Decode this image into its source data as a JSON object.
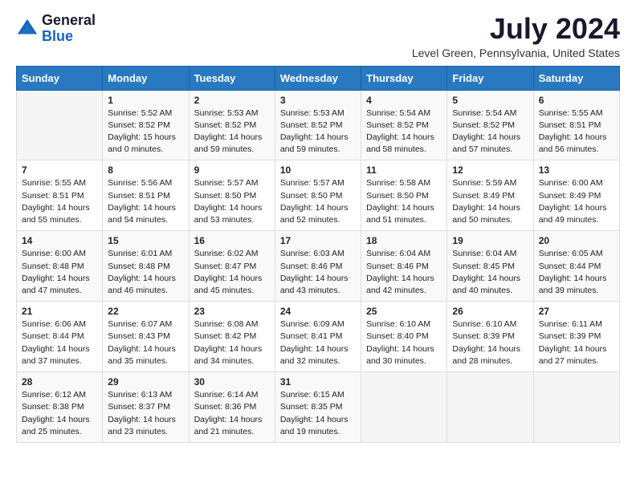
{
  "logo": {
    "general": "General",
    "blue": "Blue"
  },
  "title": "July 2024",
  "subtitle": "Level Green, Pennsylvania, United States",
  "days_of_week": [
    "Sunday",
    "Monday",
    "Tuesday",
    "Wednesday",
    "Thursday",
    "Friday",
    "Saturday"
  ],
  "weeks": [
    [
      {
        "day": "",
        "sunrise": "",
        "sunset": "",
        "daylight": ""
      },
      {
        "day": "1",
        "sunrise": "Sunrise: 5:52 AM",
        "sunset": "Sunset: 8:52 PM",
        "daylight": "Daylight: 15 hours and 0 minutes."
      },
      {
        "day": "2",
        "sunrise": "Sunrise: 5:53 AM",
        "sunset": "Sunset: 8:52 PM",
        "daylight": "Daylight: 14 hours and 59 minutes."
      },
      {
        "day": "3",
        "sunrise": "Sunrise: 5:53 AM",
        "sunset": "Sunset: 8:52 PM",
        "daylight": "Daylight: 14 hours and 59 minutes."
      },
      {
        "day": "4",
        "sunrise": "Sunrise: 5:54 AM",
        "sunset": "Sunset: 8:52 PM",
        "daylight": "Daylight: 14 hours and 58 minutes."
      },
      {
        "day": "5",
        "sunrise": "Sunrise: 5:54 AM",
        "sunset": "Sunset: 8:52 PM",
        "daylight": "Daylight: 14 hours and 57 minutes."
      },
      {
        "day": "6",
        "sunrise": "Sunrise: 5:55 AM",
        "sunset": "Sunset: 8:51 PM",
        "daylight": "Daylight: 14 hours and 56 minutes."
      }
    ],
    [
      {
        "day": "7",
        "sunrise": "Sunrise: 5:55 AM",
        "sunset": "Sunset: 8:51 PM",
        "daylight": "Daylight: 14 hours and 55 minutes."
      },
      {
        "day": "8",
        "sunrise": "Sunrise: 5:56 AM",
        "sunset": "Sunset: 8:51 PM",
        "daylight": "Daylight: 14 hours and 54 minutes."
      },
      {
        "day": "9",
        "sunrise": "Sunrise: 5:57 AM",
        "sunset": "Sunset: 8:50 PM",
        "daylight": "Daylight: 14 hours and 53 minutes."
      },
      {
        "day": "10",
        "sunrise": "Sunrise: 5:57 AM",
        "sunset": "Sunset: 8:50 PM",
        "daylight": "Daylight: 14 hours and 52 minutes."
      },
      {
        "day": "11",
        "sunrise": "Sunrise: 5:58 AM",
        "sunset": "Sunset: 8:50 PM",
        "daylight": "Daylight: 14 hours and 51 minutes."
      },
      {
        "day": "12",
        "sunrise": "Sunrise: 5:59 AM",
        "sunset": "Sunset: 8:49 PM",
        "daylight": "Daylight: 14 hours and 50 minutes."
      },
      {
        "day": "13",
        "sunrise": "Sunrise: 6:00 AM",
        "sunset": "Sunset: 8:49 PM",
        "daylight": "Daylight: 14 hours and 49 minutes."
      }
    ],
    [
      {
        "day": "14",
        "sunrise": "Sunrise: 6:00 AM",
        "sunset": "Sunset: 8:48 PM",
        "daylight": "Daylight: 14 hours and 47 minutes."
      },
      {
        "day": "15",
        "sunrise": "Sunrise: 6:01 AM",
        "sunset": "Sunset: 8:48 PM",
        "daylight": "Daylight: 14 hours and 46 minutes."
      },
      {
        "day": "16",
        "sunrise": "Sunrise: 6:02 AM",
        "sunset": "Sunset: 8:47 PM",
        "daylight": "Daylight: 14 hours and 45 minutes."
      },
      {
        "day": "17",
        "sunrise": "Sunrise: 6:03 AM",
        "sunset": "Sunset: 8:46 PM",
        "daylight": "Daylight: 14 hours and 43 minutes."
      },
      {
        "day": "18",
        "sunrise": "Sunrise: 6:04 AM",
        "sunset": "Sunset: 8:46 PM",
        "daylight": "Daylight: 14 hours and 42 minutes."
      },
      {
        "day": "19",
        "sunrise": "Sunrise: 6:04 AM",
        "sunset": "Sunset: 8:45 PM",
        "daylight": "Daylight: 14 hours and 40 minutes."
      },
      {
        "day": "20",
        "sunrise": "Sunrise: 6:05 AM",
        "sunset": "Sunset: 8:44 PM",
        "daylight": "Daylight: 14 hours and 39 minutes."
      }
    ],
    [
      {
        "day": "21",
        "sunrise": "Sunrise: 6:06 AM",
        "sunset": "Sunset: 8:44 PM",
        "daylight": "Daylight: 14 hours and 37 minutes."
      },
      {
        "day": "22",
        "sunrise": "Sunrise: 6:07 AM",
        "sunset": "Sunset: 8:43 PM",
        "daylight": "Daylight: 14 hours and 35 minutes."
      },
      {
        "day": "23",
        "sunrise": "Sunrise: 6:08 AM",
        "sunset": "Sunset: 8:42 PM",
        "daylight": "Daylight: 14 hours and 34 minutes."
      },
      {
        "day": "24",
        "sunrise": "Sunrise: 6:09 AM",
        "sunset": "Sunset: 8:41 PM",
        "daylight": "Daylight: 14 hours and 32 minutes."
      },
      {
        "day": "25",
        "sunrise": "Sunrise: 6:10 AM",
        "sunset": "Sunset: 8:40 PM",
        "daylight": "Daylight: 14 hours and 30 minutes."
      },
      {
        "day": "26",
        "sunrise": "Sunrise: 6:10 AM",
        "sunset": "Sunset: 8:39 PM",
        "daylight": "Daylight: 14 hours and 28 minutes."
      },
      {
        "day": "27",
        "sunrise": "Sunrise: 6:11 AM",
        "sunset": "Sunset: 8:39 PM",
        "daylight": "Daylight: 14 hours and 27 minutes."
      }
    ],
    [
      {
        "day": "28",
        "sunrise": "Sunrise: 6:12 AM",
        "sunset": "Sunset: 8:38 PM",
        "daylight": "Daylight: 14 hours and 25 minutes."
      },
      {
        "day": "29",
        "sunrise": "Sunrise: 6:13 AM",
        "sunset": "Sunset: 8:37 PM",
        "daylight": "Daylight: 14 hours and 23 minutes."
      },
      {
        "day": "30",
        "sunrise": "Sunrise: 6:14 AM",
        "sunset": "Sunset: 8:36 PM",
        "daylight": "Daylight: 14 hours and 21 minutes."
      },
      {
        "day": "31",
        "sunrise": "Sunrise: 6:15 AM",
        "sunset": "Sunset: 8:35 PM",
        "daylight": "Daylight: 14 hours and 19 minutes."
      },
      {
        "day": "",
        "sunrise": "",
        "sunset": "",
        "daylight": ""
      },
      {
        "day": "",
        "sunrise": "",
        "sunset": "",
        "daylight": ""
      },
      {
        "day": "",
        "sunrise": "",
        "sunset": "",
        "daylight": ""
      }
    ]
  ]
}
